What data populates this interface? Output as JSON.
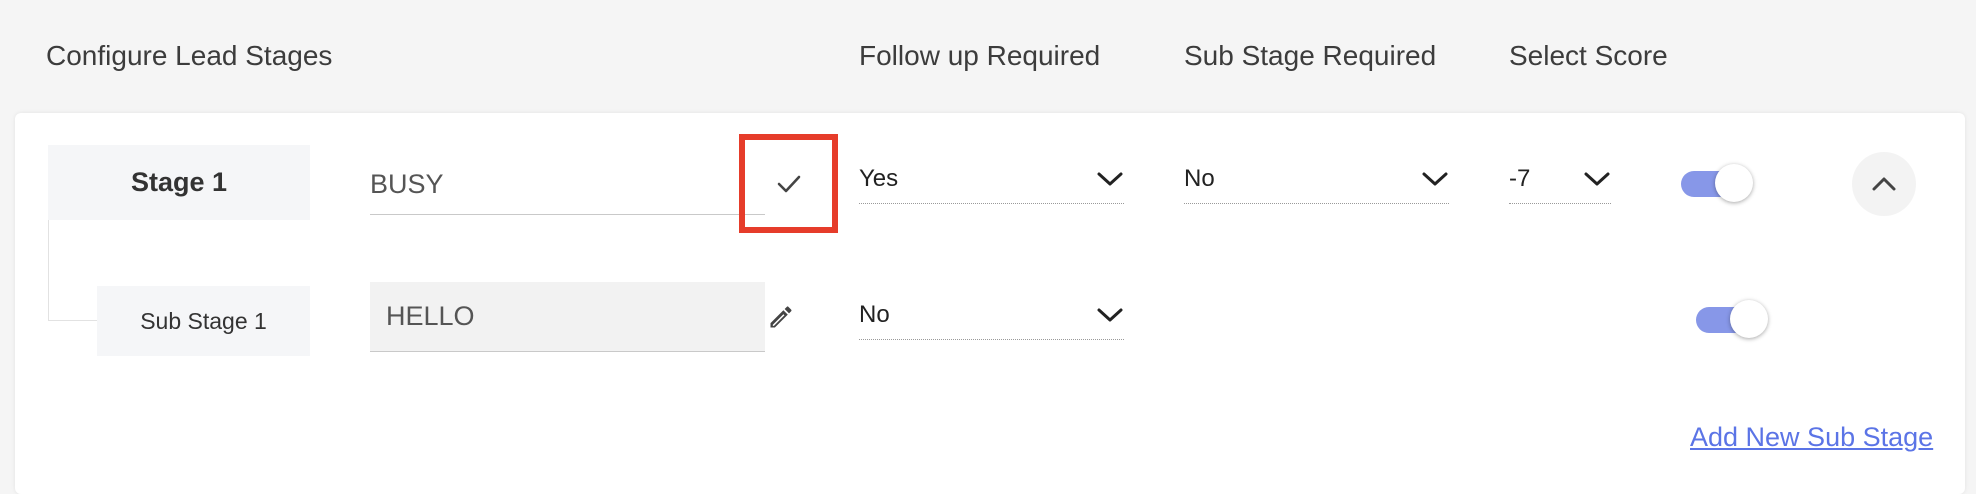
{
  "headers": {
    "configure": "Configure Lead Stages",
    "follow_up": "Follow up Required",
    "sub_stage": "Sub Stage Required",
    "score": "Select Score"
  },
  "stage": {
    "label": "Stage 1",
    "name_value": "BUSY",
    "follow_up_value": "Yes",
    "sub_stage_value": "No",
    "score_value": "-7",
    "enabled": true
  },
  "sub_stage": {
    "label": "Sub Stage 1",
    "name_value": "HELLO",
    "follow_up_value": "No",
    "enabled": true
  },
  "actions": {
    "add_sub_stage": "Add New Sub Stage"
  },
  "icons": {
    "confirm": "check-icon",
    "edit": "pencil-icon",
    "dropdown": "chevron-down-icon",
    "collapse": "chevron-up-icon"
  },
  "colors": {
    "toggle_on": "#8797e8",
    "link": "#5b74e6",
    "highlight": "#e63c2a"
  }
}
